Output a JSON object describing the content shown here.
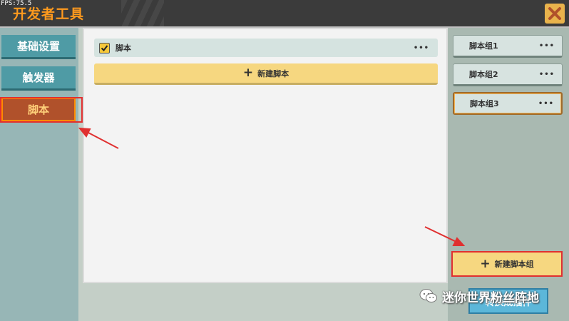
{
  "window": {
    "fps": "FPS:75.5",
    "title": "开发者工具"
  },
  "sidebar": {
    "items": [
      {
        "label": "基础设置",
        "active": false
      },
      {
        "label": "触发器",
        "active": false
      },
      {
        "label": "脚本",
        "active": true
      }
    ]
  },
  "main": {
    "scripts": [
      {
        "label": "脚本",
        "checked": true,
        "menu": "•••"
      }
    ],
    "create_script_label": "新建脚本",
    "create_icon": "+"
  },
  "groups": {
    "items": [
      {
        "label": "脚本组1",
        "menu": "•••",
        "selected": false
      },
      {
        "label": "脚本组2",
        "menu": "•••",
        "selected": false
      },
      {
        "label": "脚本组3",
        "menu": "•••",
        "selected": true
      }
    ],
    "create_group_label": "新建脚本组"
  },
  "footer": {
    "button_label": "转换成插件"
  },
  "watermark": {
    "text": "迷你世界粉丝阵地",
    "icon": "wechat-icon"
  },
  "colors": {
    "accent_orange": "#ff9a1e",
    "annotation_red": "#e03030",
    "tab_teal": "#4f9ba5",
    "tab_active": "#b0512b"
  }
}
